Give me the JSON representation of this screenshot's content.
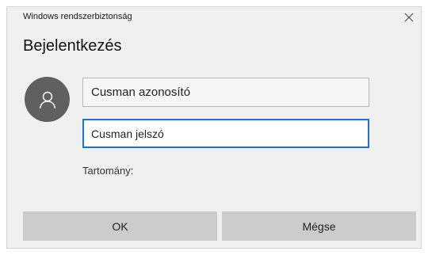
{
  "window": {
    "title": "Windows rendszerbiztonság",
    "close_icon": "close-icon"
  },
  "heading": "Bejelentkezés",
  "avatar": {
    "icon": "user-icon",
    "color": "#606060"
  },
  "username": {
    "placeholder": "Cusman azonosító",
    "value": ""
  },
  "password": {
    "placeholder": "Cusman jelszó",
    "value": "",
    "focus_color": "#1a73d6"
  },
  "domain_label": "Tartomány:",
  "buttons": {
    "ok": "OK",
    "cancel": "Mégse"
  }
}
